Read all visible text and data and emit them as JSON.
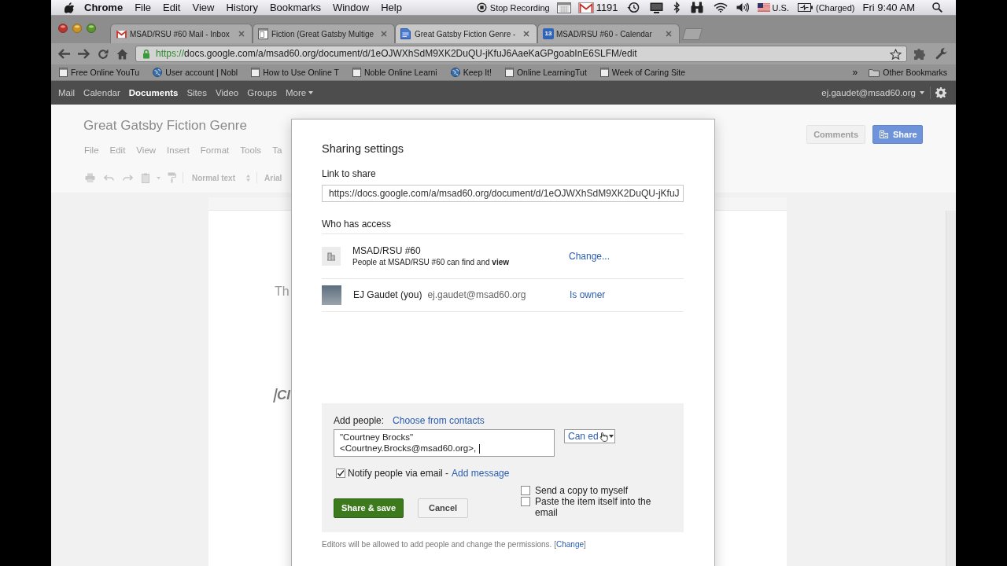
{
  "menu_bar": {
    "app": "Chrome",
    "menus": [
      "File",
      "Edit",
      "View",
      "History",
      "Bookmarks",
      "Window",
      "Help"
    ],
    "recording": "Stop Recording",
    "mail_count": "1191",
    "input_source": "U.S.",
    "battery": "(Charged)",
    "clock": "Fri 9:40 AM"
  },
  "tabs": [
    {
      "kind": "mail",
      "title": "MSAD/RSU #60 Mail - Inbox",
      "selected": false
    },
    {
      "kind": "page",
      "title": "Fiction (Great Gatsby Multige",
      "selected": false
    },
    {
      "kind": "doc",
      "title": "Great Gatsby Fiction Genre -",
      "selected": true
    },
    {
      "kind": "calendar",
      "icon_text": "13",
      "title": "MSAD/RSU #60 - Calendar",
      "selected": false
    }
  ],
  "address_bar": {
    "scheme": "https://",
    "address": "docs.google.com/a/msad60.org/document/d/1eOJWXhSdM9XK2DuQU-jKfuJ6AaeKaGPgoabInE6SLFM/edit"
  },
  "bookmarks": {
    "items": [
      {
        "kind": "page",
        "label": "Free Online YouTu"
      },
      {
        "kind": "globe",
        "label": "User account | Nobl"
      },
      {
        "kind": "page",
        "label": "How to Use Online T"
      },
      {
        "kind": "page",
        "label": "Noble Online Learni"
      },
      {
        "kind": "globe",
        "label": "Keep It!"
      },
      {
        "kind": "page",
        "label": "Online LearningTut"
      },
      {
        "kind": "page",
        "label": "Week of Caring Site"
      }
    ],
    "overflow": "»",
    "other": "Other Bookmarks"
  },
  "google_bar": {
    "links": [
      {
        "label": "Mail",
        "selected": false,
        "has_menu": false
      },
      {
        "label": "Calendar",
        "selected": false,
        "has_menu": false
      },
      {
        "label": "Documents",
        "selected": true,
        "has_menu": false
      },
      {
        "label": "Sites",
        "selected": false,
        "has_menu": false
      },
      {
        "label": "Video",
        "selected": false,
        "has_menu": false
      },
      {
        "label": "Groups",
        "selected": false,
        "has_menu": false
      },
      {
        "label": "More",
        "selected": false,
        "has_menu": true
      }
    ],
    "account": "ej.gaudet@msad60.org"
  },
  "document": {
    "title": "Great Gatsby Fiction Genre",
    "menus": [
      "File",
      "Edit",
      "View",
      "Insert",
      "Format",
      "Tools",
      "Ta"
    ],
    "paragraph_style": "Normal text",
    "font": "Arial",
    "comments_button": "Comments",
    "share_button": "Share",
    "body": [
      {
        "kind": "plain",
        "text": "Th",
        "cursor": false
      },
      {
        "kind": "heading",
        "text": "Cl",
        "cursor": true
      }
    ]
  },
  "dialog": {
    "title": "Sharing settings",
    "link_label": "Link to share",
    "link": "https://docs.google.com/a/msad60.org/document/d/1eOJWXhSdM9XK2DuQU-jKfuJ",
    "access_label": "Who has access",
    "access": [
      {
        "kind": "domain",
        "name": "MSAD/RSU #60",
        "detail": "People at MSAD/RSU #60 can find and **view**",
        "action": "Change..."
      },
      {
        "kind": "person",
        "name": "EJ Gaudet (you)",
        "email": "ej.gaudet@msad60.org",
        "action": "Is owner"
      }
    ],
    "add_people": {
      "label": "Add people:",
      "contacts_link": "Choose from contacts",
      "recipients": "\"Courtney Brocks\" <Courtney.Brocks@msad60.org>,",
      "permission": "Can ed",
      "notify": {
        "label": "Notify people via email -",
        "link": "Add message",
        "checked": true
      },
      "options": [
        {
          "label": "Send a copy to myself",
          "checked": false
        },
        {
          "label": "Paste the item itself into the email",
          "checked": false
        }
      ],
      "buttons": [
        {
          "kind": "primary",
          "label": "Share & save"
        },
        {
          "kind": "secondary",
          "label": "Cancel"
        }
      ]
    },
    "footer": {
      "text": "Editors will be allowed to add people and change the permissions.",
      "open": "[",
      "link": "Change",
      "close": "]"
    }
  }
}
